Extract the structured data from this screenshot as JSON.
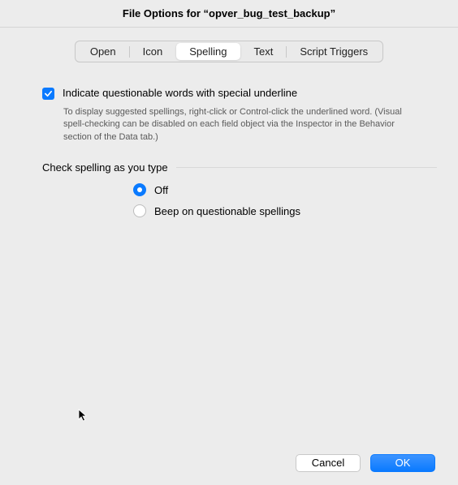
{
  "window": {
    "title": "File Options for “opver_bug_test_backup”"
  },
  "tabs": [
    {
      "label": "Open",
      "active": false
    },
    {
      "label": "Icon",
      "active": false
    },
    {
      "label": "Spelling",
      "active": true
    },
    {
      "label": "Text",
      "active": false
    },
    {
      "label": "Script Triggers",
      "active": false
    }
  ],
  "spelling": {
    "indicate_label": "Indicate questionable words with special underline",
    "indicate_checked": true,
    "description": "To display suggested spellings, right-click or Control-click the underlined word. (Visual spell-checking can be disabled on each field object via the Inspector in the Behavior section of the Data tab.)",
    "section_title": "Check spelling as you type",
    "radios": {
      "off": "Off",
      "beep": "Beep on questionable spellings",
      "selected": "off"
    }
  },
  "footer": {
    "cancel": "Cancel",
    "ok": "OK"
  }
}
